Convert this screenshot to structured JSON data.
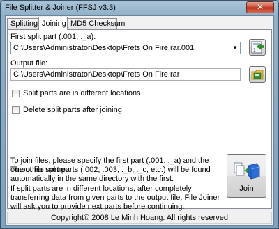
{
  "window": {
    "title": "File Splitter & Joiner (FFSJ v3.3)",
    "close_glyph": "✕"
  },
  "tabs": [
    {
      "label": "Splitting"
    },
    {
      "label": "Joining"
    },
    {
      "label": "MD5 Checksum"
    }
  ],
  "joining": {
    "first_part_label": "First split part (.001, ._a):",
    "first_part_value": "C:\\Users\\Administrator\\Desktop\\Frets On Fire.rar.001",
    "output_label": "Output file:",
    "output_value": "C:\\Users\\Administrator\\Desktop\\Frets On Fire.rar",
    "checkbox_locations": {
      "label": "Split parts are in different locations",
      "checked": false
    },
    "checkbox_delete": {
      "label": "Delete split parts after joining",
      "checked": false
    },
    "info_line1": "To join files, please specify the first part (.001, ._a) and the output file name.",
    "info_line2": "The other split parts (.002, .003, ._b, ._c, etc.) will be found automatically in the same directory with the first.",
    "info_line3": "If split parts are in different locations, after completely transferring data from given parts to the output file, File Joiner will ask you to provide next parts before continuing.",
    "join_button": "Join"
  },
  "footer": {
    "copyright": "Copyright© 2008 Le Minh Hoang. All rights reserved"
  },
  "icons": {
    "browse_first": "open-folder-green-arrow-icon",
    "browse_output": "save-folder-icon",
    "join": "join-files-icon"
  }
}
